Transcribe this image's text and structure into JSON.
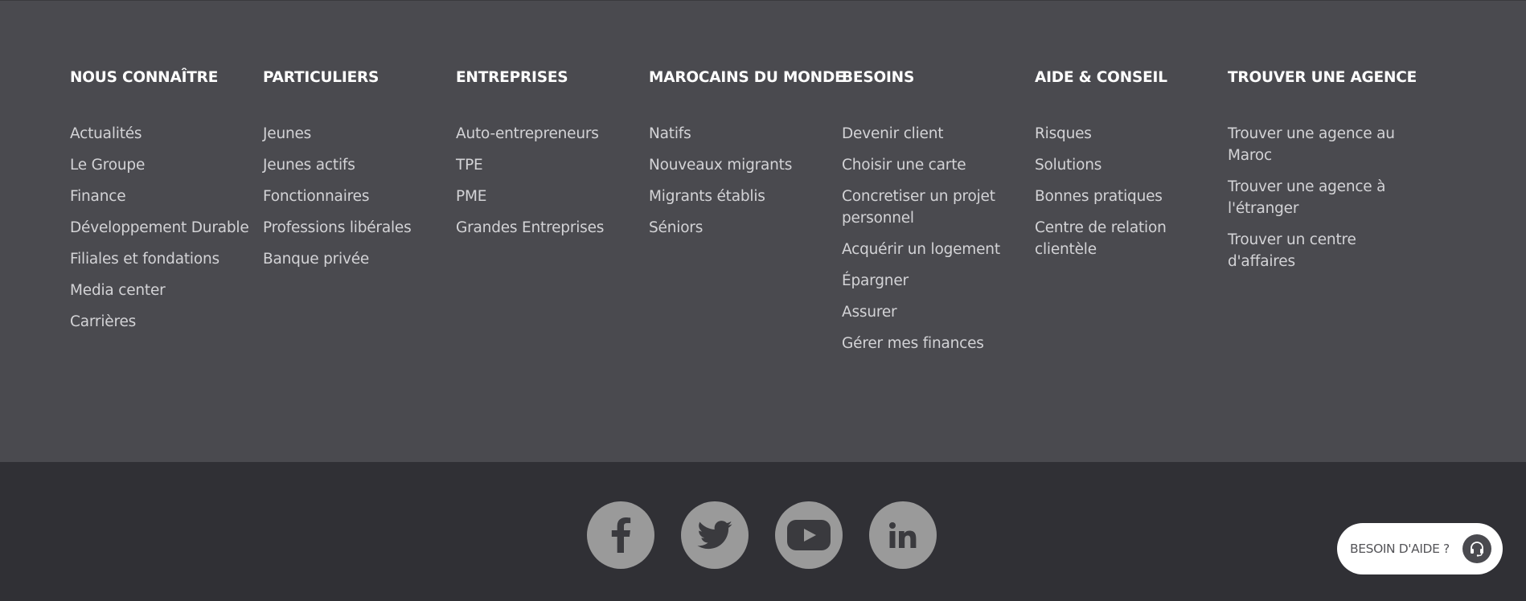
{
  "columns": [
    {
      "title": "NOUS CONNAÎTRE",
      "links": [
        "Actualités",
        "Le Groupe",
        "Finance",
        "Développement Durable",
        "Filiales et fondations",
        "Media center",
        "Carrières"
      ]
    },
    {
      "title": "PARTICULIERS",
      "links": [
        "Jeunes",
        "Jeunes actifs",
        "Fonctionnaires",
        "Professions libérales",
        "Banque privée"
      ]
    },
    {
      "title": "ENTREPRISES",
      "links": [
        "Auto-entrepreneurs",
        "TPE",
        "PME",
        "Grandes Entreprises"
      ]
    },
    {
      "title": "MAROCAINS DU MONDE",
      "links": [
        "Natifs",
        "Nouveaux migrants",
        "Migrants établis",
        "Séniors"
      ]
    },
    {
      "title": "BESOINS",
      "links": [
        "Devenir client",
        "Choisir une carte",
        "Concretiser un projet personnel",
        "Acquérir un logement",
        "Épargner",
        "Assurer",
        "Gérer mes finances"
      ]
    },
    {
      "title": "AIDE & CONSEIL",
      "links": [
        "Risques",
        "Solutions",
        "Bonnes pratiques",
        "Centre de relation clientèle"
      ]
    },
    {
      "title": "TROUVER UNE AGENCE",
      "links": [
        "Trouver une agence au Maroc",
        "Trouver une agence à l'étranger",
        "Trouver un centre d'affaires"
      ]
    }
  ],
  "social": {
    "icons": [
      "facebook-icon",
      "twitter-icon",
      "youtube-icon",
      "linkedin-icon"
    ],
    "circle_color": "#9a9a9a"
  },
  "help_button": {
    "label": "BESOIN D'AIDE ?",
    "icon": "headset-icon"
  },
  "colors": {
    "top_background": "#4a4a4f",
    "bottom_background": "#303035",
    "heading_text": "#ffffff",
    "link_text": "#d3d3d6"
  }
}
